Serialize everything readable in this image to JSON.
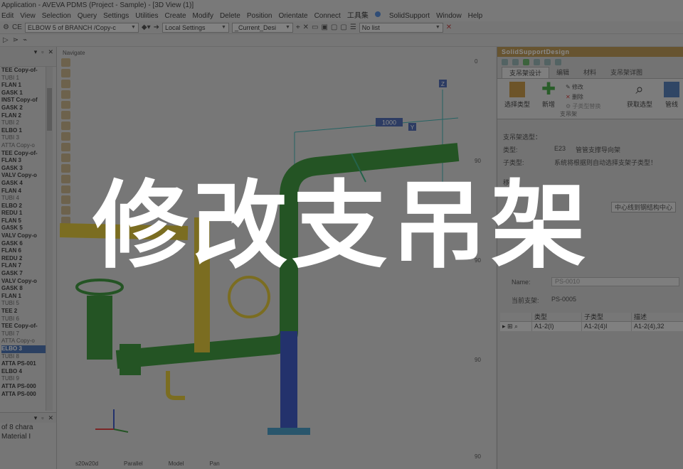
{
  "window": {
    "title": "Application - AVEVA PDMS (Project - Sample) - [3D View (1)]"
  },
  "menu": [
    "Edit",
    "View",
    "Selection",
    "Query",
    "Settings",
    "Utilities",
    "Create",
    "Modify",
    "Delete",
    "Position",
    "Orientate",
    "Connect",
    "工具集",
    "SolidSupport",
    "Window",
    "Help"
  ],
  "toolbar": {
    "ce_label": "CE",
    "element_combo": "ELBOW 5 of BRANCH /Copy-c",
    "settings_combo": "Local Settings",
    "design_combo": "_Current_Desi",
    "list_combo": "No list"
  },
  "tree": {
    "items": [
      {
        "label": "TEE Copy-of-",
        "style": "bold"
      },
      {
        "label": "TUBI 1",
        "style": "light"
      },
      {
        "label": "FLAN 1",
        "style": "bold"
      },
      {
        "label": "GASK 1",
        "style": "bold"
      },
      {
        "label": "INST Copy-of",
        "style": "bold"
      },
      {
        "label": "GASK 2",
        "style": "bold"
      },
      {
        "label": "FLAN 2",
        "style": "bold"
      },
      {
        "label": "TUBI 2",
        "style": "light"
      },
      {
        "label": "ELBO 1",
        "style": "bold"
      },
      {
        "label": "TUBI 3",
        "style": "light"
      },
      {
        "label": "ATTA Copy-o",
        "style": "light"
      },
      {
        "label": "TEE Copy-of-",
        "style": "bold"
      },
      {
        "label": "FLAN 3",
        "style": "bold"
      },
      {
        "label": "GASK 3",
        "style": "bold"
      },
      {
        "label": "VALV Copy-o",
        "style": "bold"
      },
      {
        "label": "GASK 4",
        "style": "bold"
      },
      {
        "label": "FLAN 4",
        "style": "bold"
      },
      {
        "label": "TUBI 4",
        "style": "light"
      },
      {
        "label": "ELBO 2",
        "style": "bold"
      },
      {
        "label": "REDU 1",
        "style": "bold"
      },
      {
        "label": "FLAN 5",
        "style": "bold"
      },
      {
        "label": "GASK 5",
        "style": "bold"
      },
      {
        "label": "VALV Copy-o",
        "style": "bold"
      },
      {
        "label": "GASK 6",
        "style": "bold"
      },
      {
        "label": "FLAN 6",
        "style": "bold"
      },
      {
        "label": "REDU 2",
        "style": "bold"
      },
      {
        "label": "FLAN 7",
        "style": "bold"
      },
      {
        "label": "GASK 7",
        "style": "bold"
      },
      {
        "label": "VALV Copy-o",
        "style": "bold"
      },
      {
        "label": "GASK 8",
        "style": "bold"
      },
      {
        "label": "FLAN 1",
        "style": "bold"
      },
      {
        "label": "TUBI 5",
        "style": "light"
      },
      {
        "label": "TEE 2",
        "style": "bold"
      },
      {
        "label": "TUBI 6",
        "style": "light"
      },
      {
        "label": "TEE Copy-of-",
        "style": "bold"
      },
      {
        "label": "TUBI 7",
        "style": "light"
      },
      {
        "label": "ATTA Copy-o",
        "style": "light"
      },
      {
        "label": "ELBO 3",
        "style": "selected"
      },
      {
        "label": "TUBI 8",
        "style": "light"
      },
      {
        "label": "ATTA PS-001",
        "style": "bold"
      },
      {
        "label": "ELBO 4",
        "style": "bold"
      },
      {
        "label": "TUBI 9",
        "style": "light"
      },
      {
        "label": "ATTA PS-000",
        "style": "bold"
      },
      {
        "label": "ATTA PS-000",
        "style": "bold"
      }
    ]
  },
  "left_bottom": {
    "line1": "of 8 chara",
    "line2": "Material I"
  },
  "view": {
    "label": "Navigate",
    "dimension_label": "1000",
    "axis_z": "Z",
    "axis_y": "Y",
    "tick_labels": [
      "0",
      "90",
      "90",
      "90",
      "90"
    ],
    "status": [
      "s20w20d",
      "Parallel",
      "Model",
      "Pan"
    ]
  },
  "right_panel": {
    "title": "SolidSupportDesign",
    "tabs": [
      "支吊架设计",
      "编辑",
      "材料",
      "支吊架详图"
    ],
    "ribbon": {
      "select_type": "选择类型",
      "add": "新增",
      "modify": "修改",
      "delete": "删除",
      "sub_type_replace": "子类型替换",
      "get_selected": "获取选型",
      "group_label": "支吊架",
      "partial": "管线"
    },
    "section_title": "支吊架选型：",
    "type_label": "类型:",
    "type_value": "E23",
    "type_desc": "管管支撑导向架",
    "subtype_label": "子类型:",
    "subtype_desc": "系统将根据则自动选择支架子类型！",
    "move_label": "移动",
    "center_label": "中心线到钢结构中心",
    "name_label": "Name:",
    "name_value": "PS-0010",
    "current_label": "当前支架:",
    "current_value": "PS-0005",
    "grid": {
      "headers": [
        "",
        "类型",
        "子类型",
        "描述"
      ],
      "rows": [
        [
          "",
          "A1-2(I)",
          "A1-2(4)I",
          "A1-2(4),32"
        ]
      ]
    }
  },
  "headline": "修改支吊架",
  "colors": {
    "pipe_green": "#1f8a1f",
    "pipe_yellow": "#e0c21a",
    "pipe_blue": "#1d3fbf",
    "panel_title": "#b48a3a"
  }
}
